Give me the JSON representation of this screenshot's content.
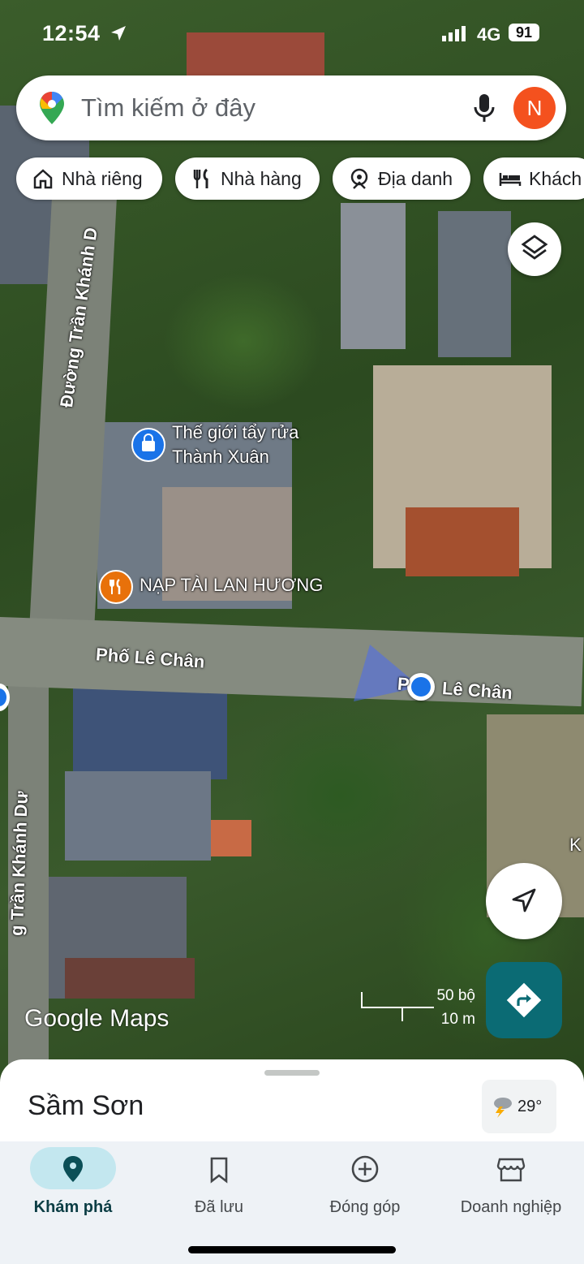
{
  "status_bar": {
    "time": "12:54",
    "network": "4G",
    "battery": "91"
  },
  "search": {
    "placeholder": "Tìm kiếm ở đây",
    "avatar_letter": "N"
  },
  "chips": [
    {
      "label": "Nhà riêng",
      "icon": "home-icon"
    },
    {
      "label": "Nhà hàng",
      "icon": "restaurant-icon"
    },
    {
      "label": "Địa danh",
      "icon": "landmark-icon"
    },
    {
      "label": "Khách",
      "icon": "hotel-icon"
    }
  ],
  "map": {
    "pois": [
      {
        "line1": "Thế giới tẩy rửa",
        "line2": "Thành Xuân",
        "icon": "shopping-bag-icon",
        "color": "#1a73e8"
      },
      {
        "line1": "NẠP TÀI LAN HƯƠNG",
        "icon": "restaurant-icon",
        "color": "#e8710a"
      }
    ],
    "streets": {
      "vertical_top": "Đường Trần Khánh D",
      "vertical_bottom": "g Trần Khánh Dư",
      "main_left": "Phố Lê Chân",
      "main_right_prefix": "P",
      "main_right": "Lê Chân",
      "edge_right": "K"
    },
    "scale": {
      "imperial": "50 bộ",
      "metric": "10 m"
    },
    "logo": "Google Maps"
  },
  "sheet": {
    "place": "Sầm Sơn",
    "temperature": "29°"
  },
  "bottom_nav": [
    {
      "label": "Khám phá",
      "icon": "explore-pin-icon",
      "active": true
    },
    {
      "label": "Đã lưu",
      "icon": "bookmark-icon",
      "active": false
    },
    {
      "label": "Đóng góp",
      "icon": "add-circle-icon",
      "active": false
    },
    {
      "label": "Doanh nghiệp",
      "icon": "storefront-icon",
      "active": false
    }
  ],
  "colors": {
    "accent": "#0b6b74",
    "avatar": "#f4511e",
    "location_dot": "#1a73e8",
    "active_pill": "#c3e7ef"
  }
}
